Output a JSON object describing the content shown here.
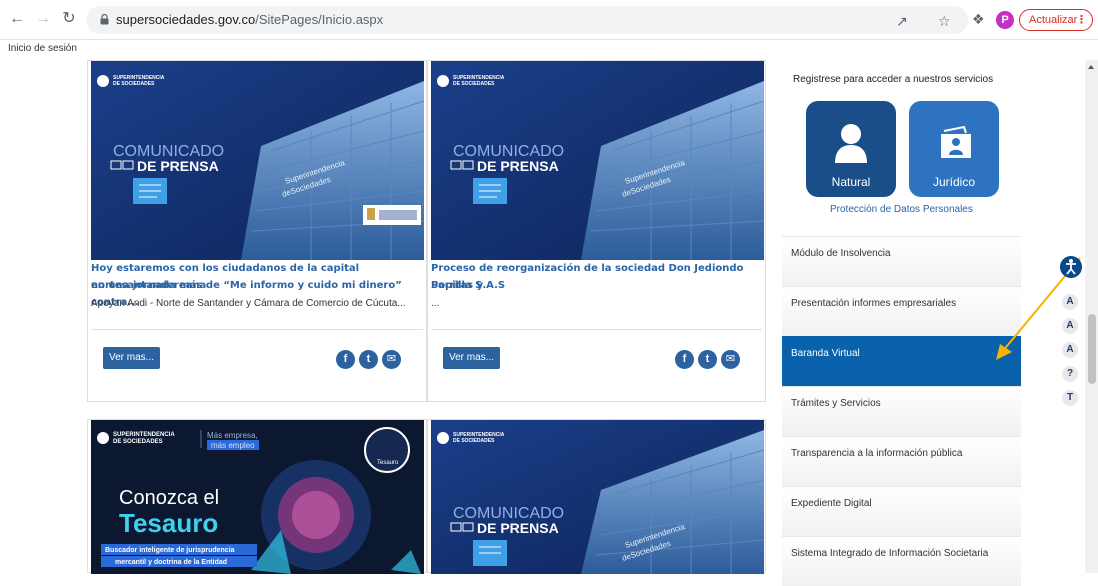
{
  "browser": {
    "url_host": "supersociedades.gov.co",
    "url_path": "/SitePages/Inicio.aspx",
    "profile_initial": "P",
    "update_label": "Actualizar"
  },
  "page": {
    "login_link": "Inicio de sesión"
  },
  "cards": [
    {
      "title_line1": "Hoy estaremos con los ciudadanos de la capital nortesantandereana",
      "title_line2": "en una jornada más de “Me informo y cuido mi dinero” contra...",
      "desc": "Apoyan Andi - Norte de Santander y Cámara de Comercio de Cúcuta...",
      "btn": "Ver mas...",
      "img": {
        "brand_top": "SUPERINTENDENCIA",
        "brand_bottom": "DE SOCIEDADES",
        "heading_light": "COMUNICADO",
        "heading_bold": "DE PRENSA",
        "building_line1": "Superintendencia",
        "building_line2": "deSociedades"
      }
    },
    {
      "title_line1": "Proceso de reorganización de la sociedad Don Jediondo Sopitas y",
      "title_line2": "Parrilla S.A.S",
      "desc": "...",
      "btn": "Ver mas...",
      "img": {
        "brand_top": "SUPERINTENDENCIA",
        "brand_bottom": "DE SOCIEDADES",
        "heading_light": "COMUNICADO",
        "heading_bold": "DE PRENSA",
        "building_line1": "Superintendencia",
        "building_line2": "deSociedades"
      }
    }
  ],
  "bottom_cards": [
    {
      "brand_top": "SUPERINTENDENCIA",
      "brand_bottom": "DE SOCIEDADES",
      "slogan_top": "Más empresa,",
      "slogan_bottom": "más empleo",
      "badge": "Tesauro",
      "heading_light": "Conozca el",
      "heading_bold": "Tesauro",
      "sub_line1": "Buscador inteligente de jurisprudencia",
      "sub_line2": "mercantil y doctrina de la Entidad"
    },
    {
      "brand_top": "SUPERINTENDENCIA",
      "brand_bottom": "DE SOCIEDADES",
      "heading_light": "COMUNICADO",
      "heading_bold": "DE PRENSA",
      "building_line1": "Superintendencia",
      "building_line2": "deSociedades"
    }
  ],
  "right_panel": {
    "register_text": "Registrese para acceder a nuestros servicios",
    "natural_label": "Natural",
    "juridico_label": "Jurídico",
    "privacy_link": "Protección de Datos Personales",
    "menu": [
      "Módulo de Insolvencia",
      "Presentación informes empresariales",
      "Baranda Virtual",
      "Trámites y Servicios",
      "Transparencia a la información pública",
      "Expediente Digital",
      "Sistema Integrado de Información Societaria"
    ],
    "active_index": 2
  },
  "accessibility": {
    "btn_increase": "A",
    "btn_normal": "A",
    "btn_decrease": "A",
    "btn_help": "?",
    "btn_text": "T"
  },
  "colors": {
    "brand_blue": "#2d62a0",
    "active_menu": "#0a62ad",
    "arrow": "#f5b400"
  }
}
